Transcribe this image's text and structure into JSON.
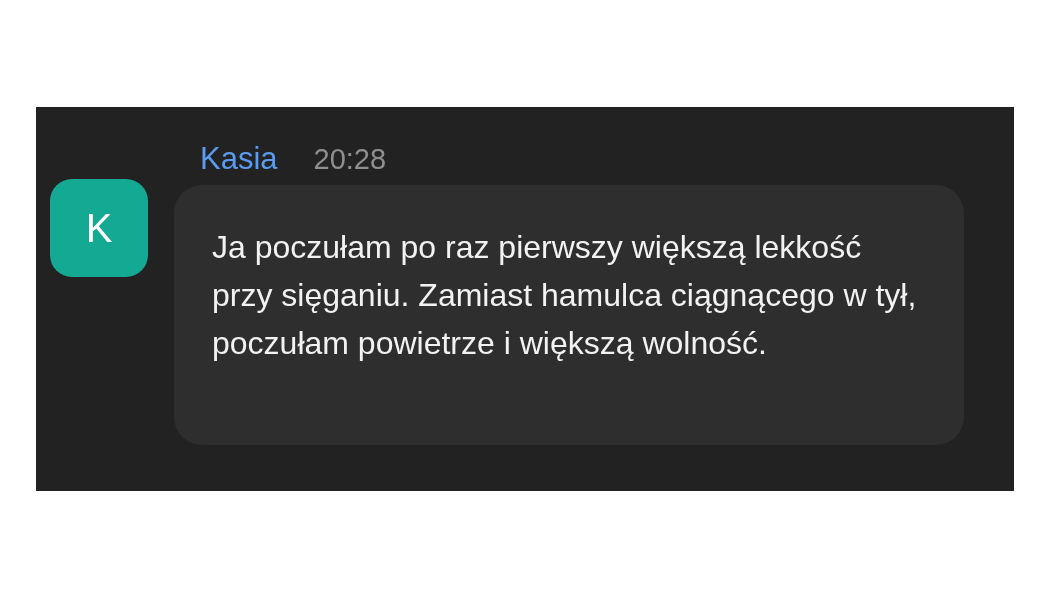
{
  "message": {
    "avatar": "K",
    "author": "Kasia",
    "time": "20:28",
    "text": "Ja poczułam po raz pierwszy większą lekkość przy sięganiu. Zamiast hamulca ciągnącego w tył, poczułam powietrze i większą wolność."
  }
}
